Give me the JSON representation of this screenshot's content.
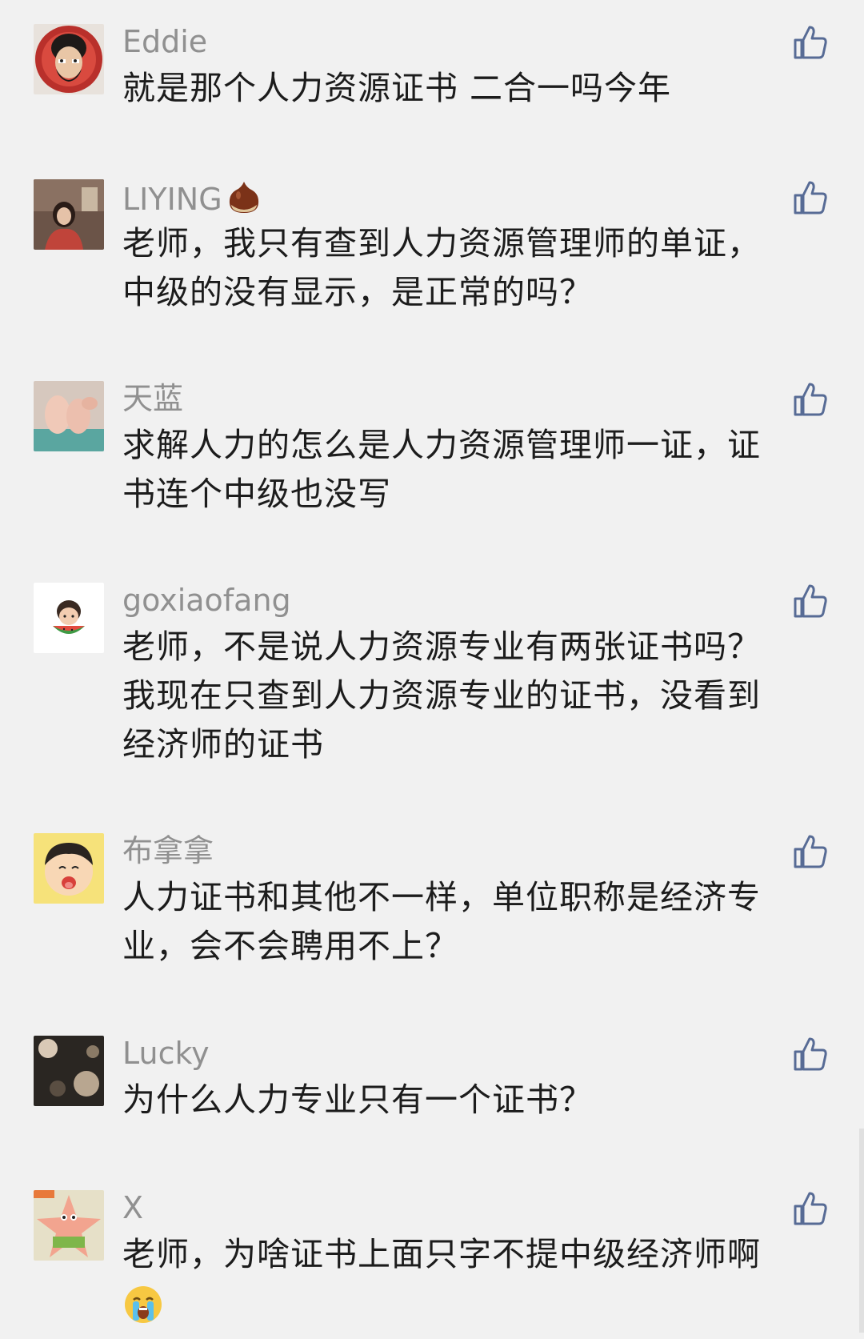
{
  "comments": [
    {
      "user": "Eddie",
      "lines": [
        "就是那个人力资源证书 二合一吗今年"
      ],
      "avatar_icon": "cartoon-bearded-man-avatar"
    },
    {
      "user": "LIYING",
      "user_emoji": "chestnut-icon",
      "lines": [
        "老师，我只有查到人力资源管理师的单证，",
        "中级的没有显示，是正常的吗？"
      ],
      "avatar_icon": "person-photo-avatar"
    },
    {
      "user": "天蓝",
      "lines": [
        "求解人力的怎么是人力资源管理师一证，证",
        "书连个中级也没写"
      ],
      "avatar_icon": "baby-feet-photo-avatar"
    },
    {
      "user": "goxiaofang",
      "lines": [
        "老师，不是说人力资源专业有两张证书吗？",
        "我现在只查到人力资源专业的证书，没看到",
        "经济师的证书"
      ],
      "avatar_icon": "kid-watermelon-avatar"
    },
    {
      "user": "布拿拿",
      "lines": [
        "人力证书和其他不一样，单位职称是经济专",
        "业，会不会聘用不上？"
      ],
      "avatar_icon": "cartoon-boy-avatar"
    },
    {
      "user": "Lucky",
      "lines": [
        "为什么人力专业只有一个证书？"
      ],
      "avatar_icon": "dark-photo-avatar"
    },
    {
      "user": "X",
      "lines": [
        "老师，为啥证书上面只字不提中级经济师啊"
      ],
      "trailing_emoji": "crying-face-icon",
      "avatar_icon": "patrick-star-avatar"
    }
  ],
  "colors": {
    "background": "#f1f1f1",
    "username": "#909090",
    "text": "#1c1c1c",
    "like_icon": "#576b95"
  }
}
